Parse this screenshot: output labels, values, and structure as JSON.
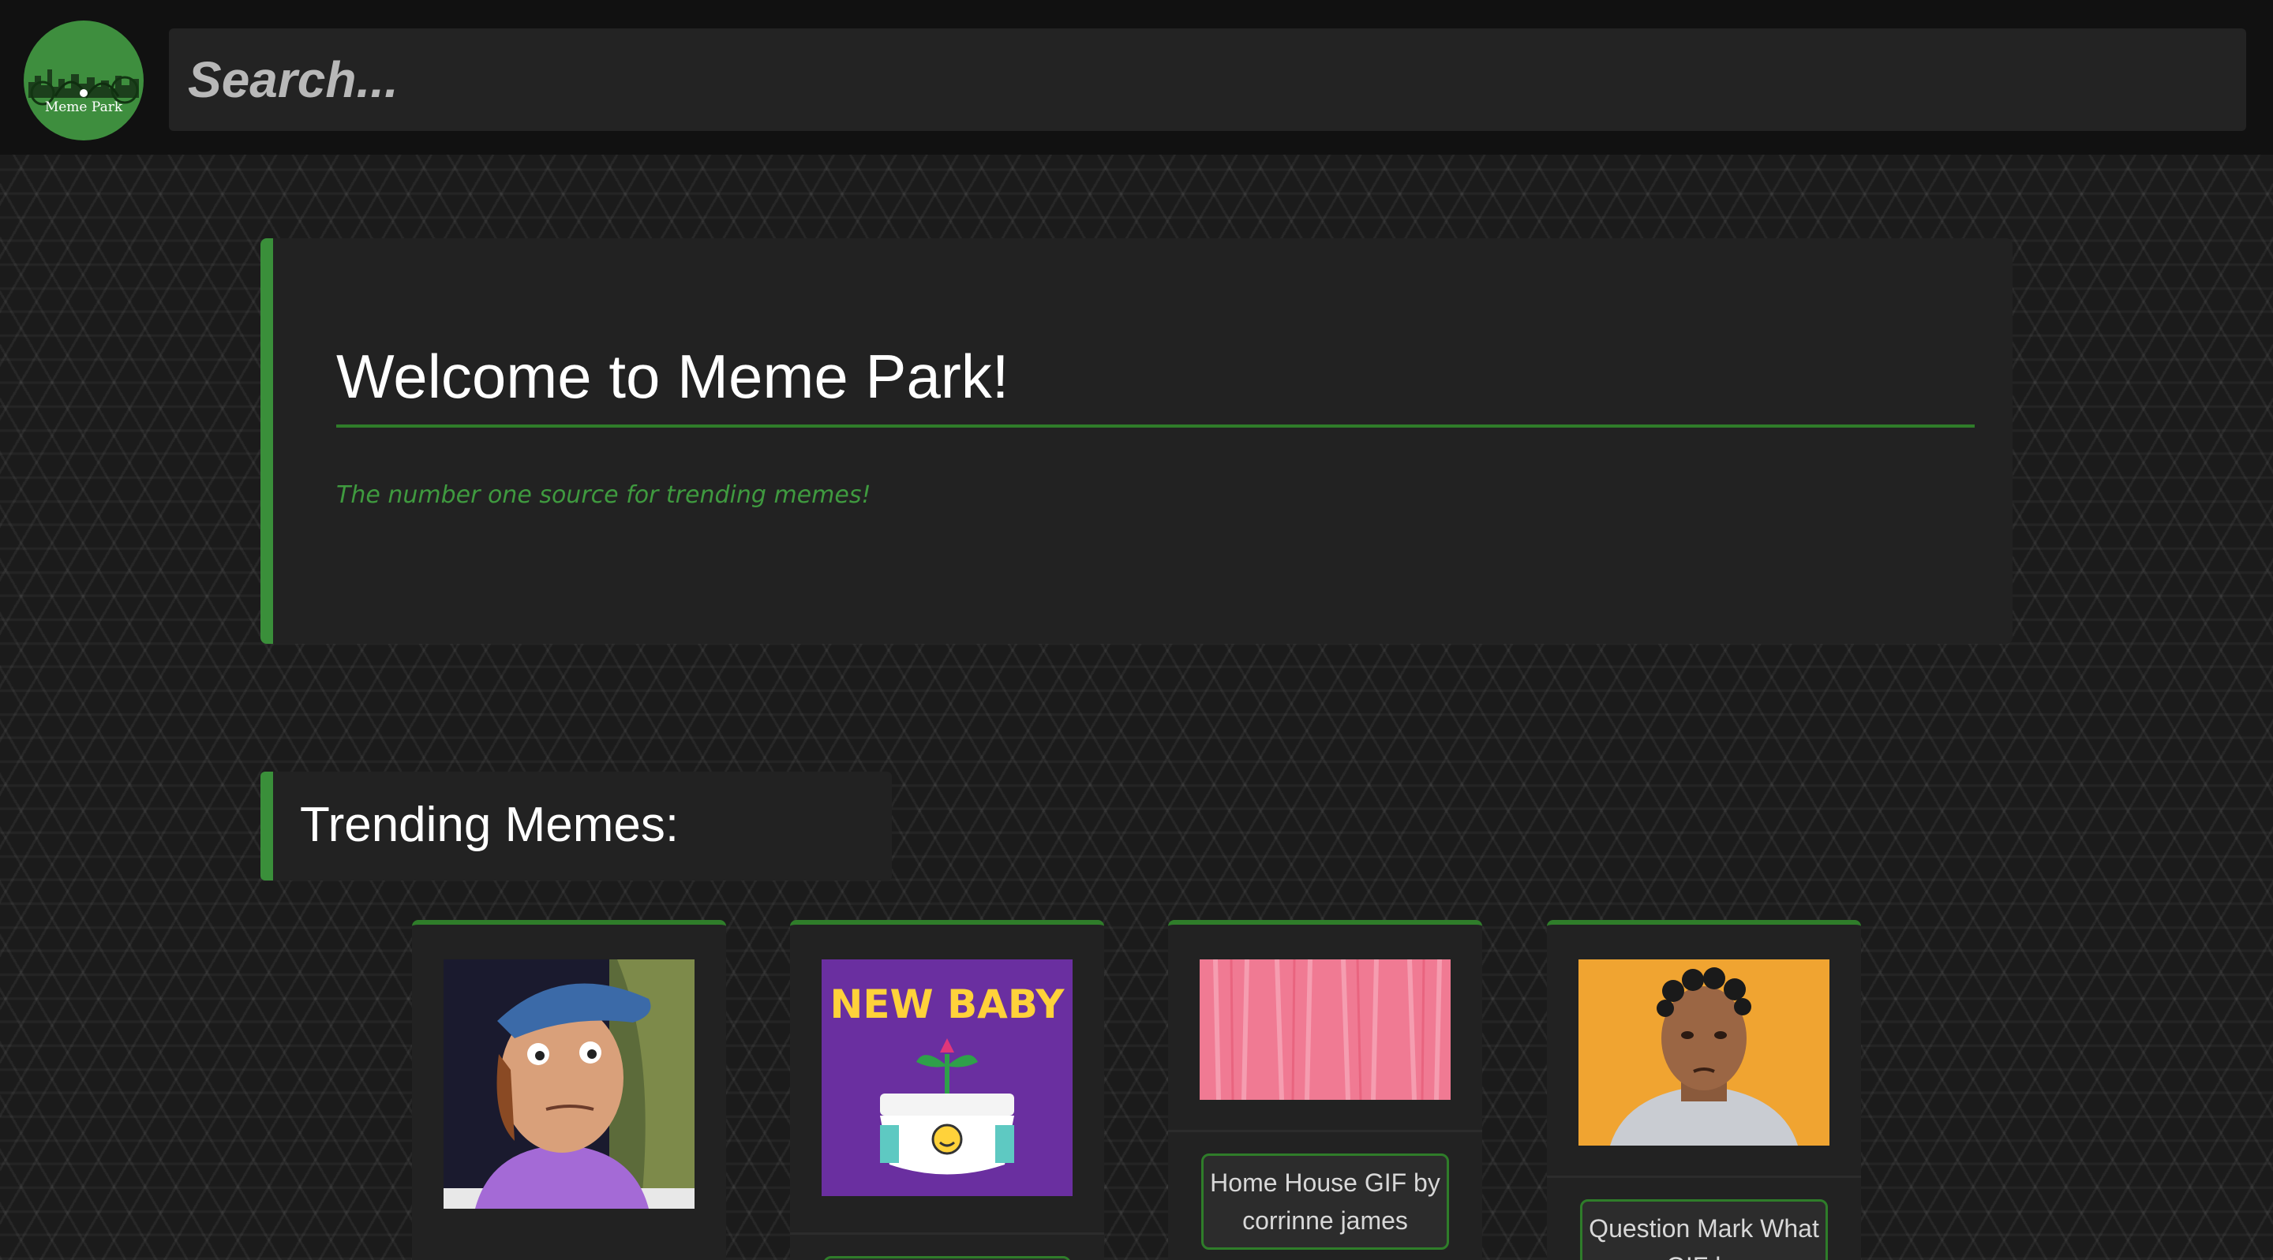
{
  "header": {
    "logo_text": "Meme Park",
    "search_placeholder": "Search..."
  },
  "welcome": {
    "title": "Welcome to Meme Park!",
    "tagline": "The number one source for trending memes!"
  },
  "trending": {
    "heading": "Trending Memes:",
    "memes": [
      {
        "caption": "",
        "image": "cartoon-boy-cap"
      },
      {
        "caption": "",
        "image": "new-baby-diaper",
        "image_text": "NEW BABY"
      },
      {
        "caption": "Home House GIF by corrinne james",
        "image": "pink-texture"
      },
      {
        "caption": "Question Mark What GIF by",
        "image": "man-orange-background"
      }
    ]
  },
  "colors": {
    "accent_green": "#3a8f3a",
    "card_bg": "#222222",
    "header_bg": "#111111"
  }
}
